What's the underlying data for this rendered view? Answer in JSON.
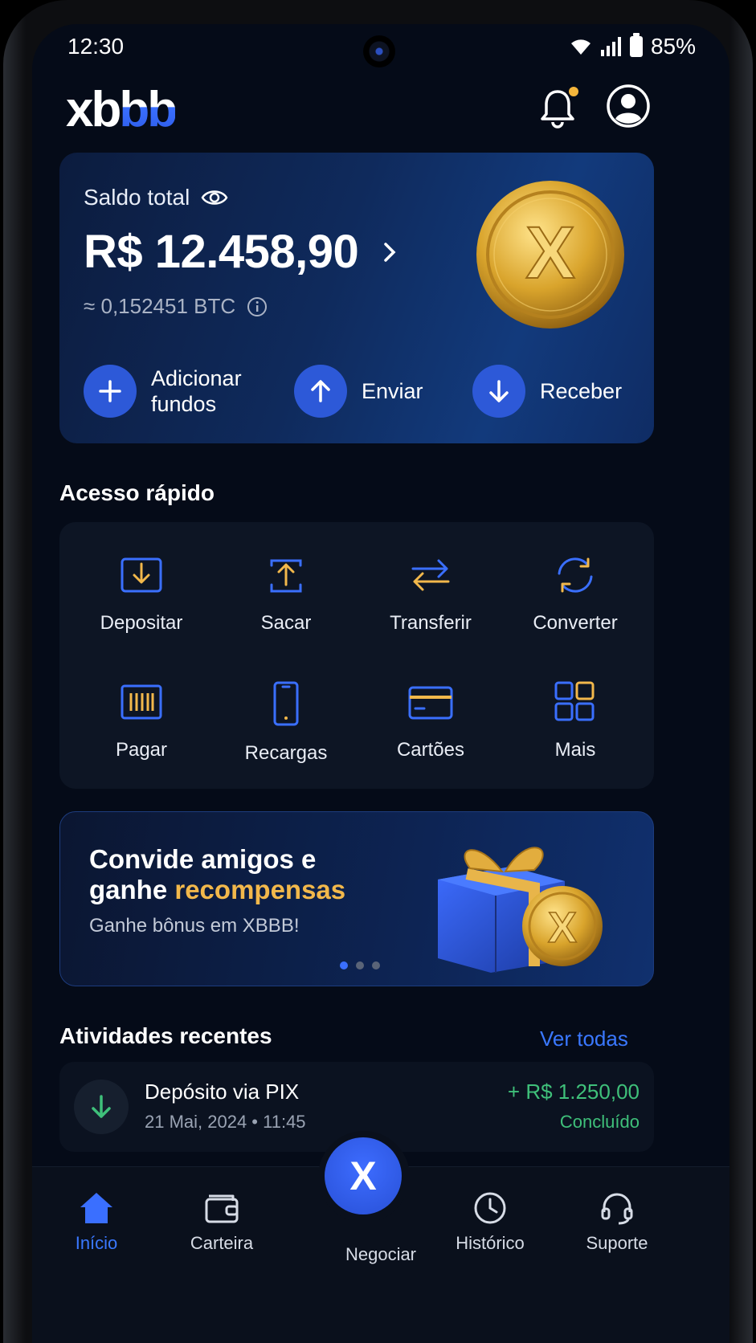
{
  "status_bar": {
    "time": "12:30",
    "battery": "85%"
  },
  "header": {
    "logo_part1": "xb",
    "logo_part2": "bb"
  },
  "balance": {
    "label": "Saldo total",
    "value": "R$ 12.458,90",
    "btc": "≈ 0,152451 BTC",
    "actions": [
      {
        "label_line1": "Adicionar",
        "label_line2": "fundos",
        "icon": "plus-icon"
      },
      {
        "label": "Enviar",
        "icon": "arrow-up-icon"
      },
      {
        "label": "Receber",
        "icon": "arrow-down-icon"
      }
    ]
  },
  "quick_access": {
    "title": "Acesso rápido",
    "items": [
      {
        "label": "Depositar",
        "icon": "deposit-icon"
      },
      {
        "label": "Sacar",
        "icon": "withdraw-icon"
      },
      {
        "label": "Transferir",
        "icon": "transfer-icon"
      },
      {
        "label": "Converter",
        "icon": "convert-icon"
      },
      {
        "label": "Pagar",
        "icon": "barcode-icon"
      },
      {
        "label": "Recargas",
        "icon": "phone-icon"
      },
      {
        "label": "Cartões",
        "icon": "card-icon"
      },
      {
        "label": "Mais",
        "icon": "grid-icon"
      }
    ]
  },
  "promo": {
    "title_line1": "Convide amigos e",
    "title_line2_prefix": "ganhe ",
    "title_line2_highlight": "recompensas",
    "subtitle": "Ganhe bônus em XBBB!",
    "slide_count": 3,
    "active_slide": 1
  },
  "activities": {
    "title": "Atividades recentes",
    "see_all": "Ver todas",
    "items": [
      {
        "title": "Depósito via PIX",
        "date": "21 Mai, 2024 • 11:45",
        "amount": "+ R$ 1.250,00",
        "status": "Concluído"
      }
    ]
  },
  "bottom_nav": {
    "items": [
      {
        "label": "Início",
        "icon": "home-icon",
        "active": true
      },
      {
        "label": "Carteira",
        "icon": "wallet-icon"
      },
      {
        "label": "Negociar",
        "icon": "x-logo-icon"
      },
      {
        "label": "Histórico",
        "icon": "clock-icon"
      },
      {
        "label": "Suporte",
        "icon": "headset-icon"
      }
    ],
    "fab_glyph": "X"
  },
  "colors": {
    "accent_blue": "#2d59d8",
    "link_blue": "#3a78ff",
    "gold": "#f2b84b",
    "success_green": "#3fc07a",
    "background": "#050b18"
  }
}
